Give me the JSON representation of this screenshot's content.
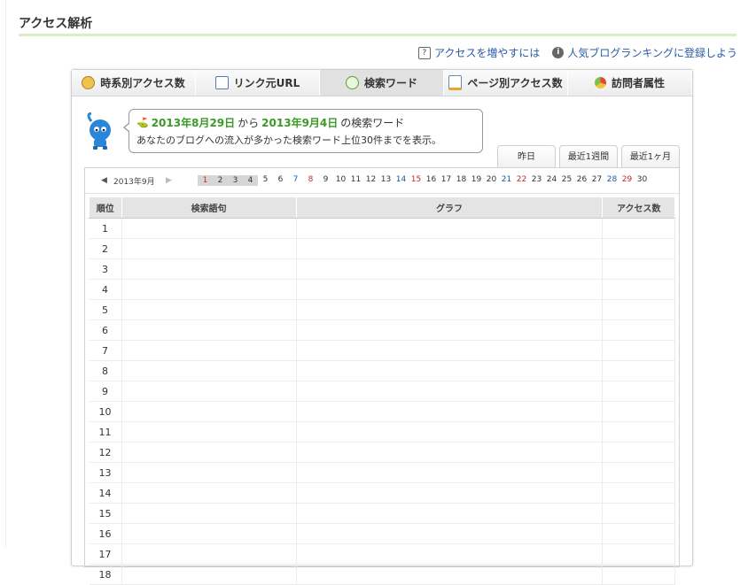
{
  "page": {
    "title": "アクセス解析",
    "links": [
      {
        "label": "アクセスを増やすには",
        "icon": "question-icon"
      },
      {
        "label": "人気ブログランキングに登録しよう",
        "icon": "info-icon"
      }
    ]
  },
  "tabs": [
    {
      "label": "時系別アクセス数",
      "icon": "clock-icon",
      "active": false
    },
    {
      "label": "リンク元URL",
      "icon": "window-icon",
      "active": false
    },
    {
      "label": "検索ワード",
      "icon": "speech-bubble-icon",
      "active": true
    },
    {
      "label": "ページ別アクセス数",
      "icon": "page-icon",
      "active": false
    },
    {
      "label": "訪問者属性",
      "icon": "pie-icon",
      "active": false
    }
  ],
  "bubble": {
    "start": "2013年8月29日",
    "from": "から",
    "end": "2013年9月4日",
    "suffix": "の検索ワード",
    "desc": "あなたのブログへの流入が多かった検索ワード上位30件までを表示。"
  },
  "range_tabs": [
    "昨日",
    "最近1週間",
    "最近1ヶ月"
  ],
  "calendar": {
    "month": "2013年9月",
    "days": [
      {
        "d": "1",
        "style": "hl-red"
      },
      {
        "d": "2",
        "style": "hl"
      },
      {
        "d": "3",
        "style": "hl"
      },
      {
        "d": "4",
        "style": "hl"
      },
      {
        "d": "5",
        "style": ""
      },
      {
        "d": "6",
        "style": ""
      },
      {
        "d": "7",
        "style": "blue"
      },
      {
        "d": "8",
        "style": "red"
      },
      {
        "d": "9",
        "style": ""
      },
      {
        "d": "10",
        "style": ""
      },
      {
        "d": "11",
        "style": ""
      },
      {
        "d": "12",
        "style": ""
      },
      {
        "d": "13",
        "style": ""
      },
      {
        "d": "14",
        "style": "blue"
      },
      {
        "d": "15",
        "style": "red"
      },
      {
        "d": "16",
        "style": ""
      },
      {
        "d": "17",
        "style": ""
      },
      {
        "d": "18",
        "style": ""
      },
      {
        "d": "19",
        "style": ""
      },
      {
        "d": "20",
        "style": ""
      },
      {
        "d": "21",
        "style": "blue"
      },
      {
        "d": "22",
        "style": "red"
      },
      {
        "d": "23",
        "style": ""
      },
      {
        "d": "24",
        "style": ""
      },
      {
        "d": "25",
        "style": ""
      },
      {
        "d": "26",
        "style": ""
      },
      {
        "d": "27",
        "style": ""
      },
      {
        "d": "28",
        "style": "blue"
      },
      {
        "d": "29",
        "style": "red"
      },
      {
        "d": "30",
        "style": ""
      }
    ]
  },
  "table": {
    "headers": [
      "順位",
      "検索語句",
      "グラフ",
      "アクセス数"
    ],
    "ranks": [
      "1",
      "2",
      "3",
      "4",
      "5",
      "6",
      "7",
      "8",
      "9",
      "10",
      "11",
      "12",
      "13",
      "14",
      "15",
      "16",
      "17",
      "18"
    ]
  }
}
